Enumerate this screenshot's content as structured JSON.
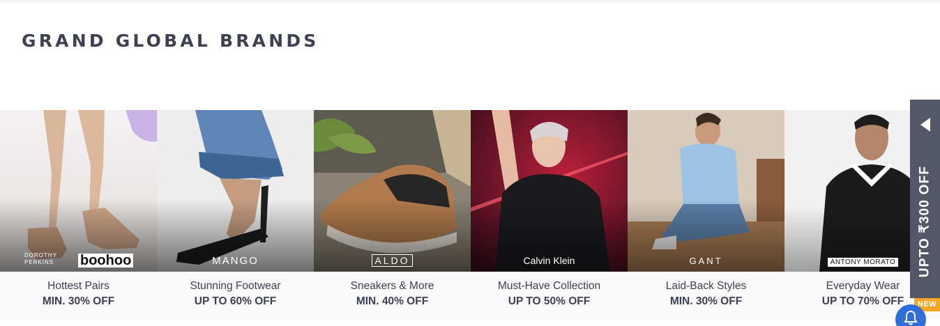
{
  "section": {
    "title": "GRAND GLOBAL BRANDS"
  },
  "cards": [
    {
      "title": "Hottest Pairs",
      "offer": "MIN. 30% OFF",
      "logo_secondary": "DOROTHY PERKINS",
      "logo": "boohoo"
    },
    {
      "title": "Stunning Footwear",
      "offer": "UP TO 60% OFF",
      "logo": "MANGO"
    },
    {
      "title": "Sneakers & More",
      "offer": "MIN. 40% OFF",
      "logo": "ALDO"
    },
    {
      "title": "Must-Have Collection",
      "offer": "UP TO 50% OFF",
      "logo": "Calvin Klein"
    },
    {
      "title": "Laid-Back Styles",
      "offer": "MIN. 30% OFF",
      "logo": "GANT"
    },
    {
      "title": "Everyday Wear",
      "offer": "UP TO 70% OFF",
      "logo": "ANTONY MORATO"
    }
  ],
  "side_offer": {
    "text": "UPTO ₹300 OFF",
    "badge": "NEW"
  },
  "colors": {
    "title": "#3e4152",
    "side_tab": "#535766",
    "badge": "#f5a623",
    "notify": "#2f6ddb"
  },
  "icons": {
    "side_tab_arrow": "triangle-left-icon",
    "notify": "bell-icon"
  }
}
